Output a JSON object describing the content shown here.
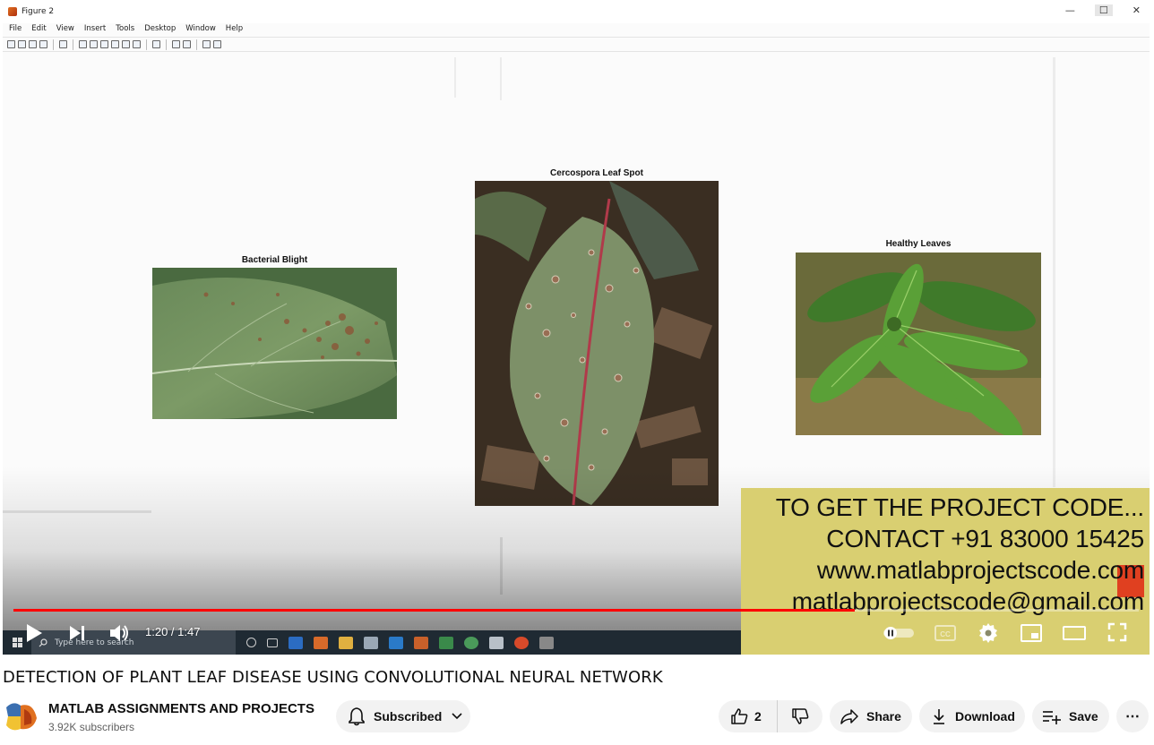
{
  "matlab": {
    "window_title": "Figure 2",
    "menu": [
      "File",
      "Edit",
      "View",
      "Insert",
      "Tools",
      "Desktop",
      "Window",
      "Help"
    ],
    "win_buttons": [
      "—",
      "☐",
      "✕"
    ]
  },
  "figure": {
    "subplots": [
      {
        "title": "Bacterial Blight",
        "image": "bacterial-blight-leaf"
      },
      {
        "title": "Cercospora Leaf Spot",
        "image": "cercospora-leaf"
      },
      {
        "title": "Healthy Leaves",
        "image": "healthy-leaves"
      }
    ]
  },
  "taskbar": {
    "search_placeholder": "Type here to search"
  },
  "promo": {
    "lines": [
      "TO GET THE PROJECT CODE...",
      "CONTACT +91 83000 15425",
      "www.matlabprojectscode.com",
      "matlabprojectscode@gmail.com"
    ]
  },
  "player": {
    "current_time": "1:20",
    "duration": "1:47",
    "time_display": "1:20 / 1:47",
    "progress_fraction": 0.748,
    "autoplay": "paused",
    "controls": {
      "left": [
        "play-icon",
        "next-icon",
        "volume-icon"
      ],
      "right": [
        "autoplay-toggle",
        "cc-icon",
        "settings-icon",
        "miniplayer-icon",
        "theater-icon",
        "fullscreen-icon"
      ]
    }
  },
  "video": {
    "title": "DETECTION OF PLANT LEAF DISEASE USING CONVOLUTIONAL NEURAL NETWORK"
  },
  "channel": {
    "name": "MATLAB ASSIGNMENTS AND PROJECTS",
    "subscribers": "3.92K subscribers",
    "subscribe_label": "Subscribed"
  },
  "actions": {
    "like_count": "2",
    "share_label": "Share",
    "download_label": "Download",
    "save_label": "Save",
    "more_label": "⋯"
  },
  "colors": {
    "progress": "#ff0000",
    "promo_bg": "#d9cf71",
    "pill_bg": "#f2f2f2",
    "taskbar_bg": "#1f2a33"
  }
}
